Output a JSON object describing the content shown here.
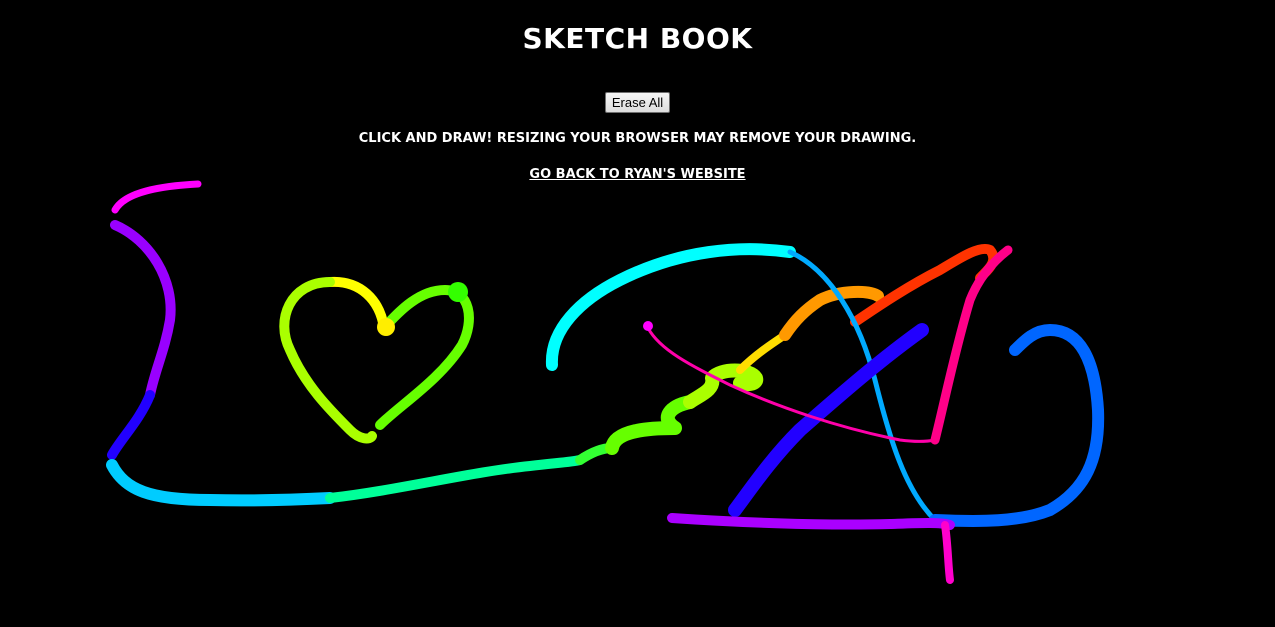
{
  "header": {
    "title": "SKETCH BOOK"
  },
  "controls": {
    "erase_label": "Erase All"
  },
  "instructions": "CLICK AND DRAW! RESIZING YOUR BROWSER MAY REMOVE YOUR DRAWING.",
  "back_link": {
    "label": "GO BACK TO RYAN'S WEBSITE"
  },
  "canvas": {
    "background": "#000000",
    "stroke_colors": [
      "#ff00ff",
      "#8800ff",
      "#0000ff",
      "#00ccff",
      "#00ff99",
      "#66ff00",
      "#ffff00",
      "#ff8800",
      "#ff0000",
      "#ff0088"
    ]
  }
}
